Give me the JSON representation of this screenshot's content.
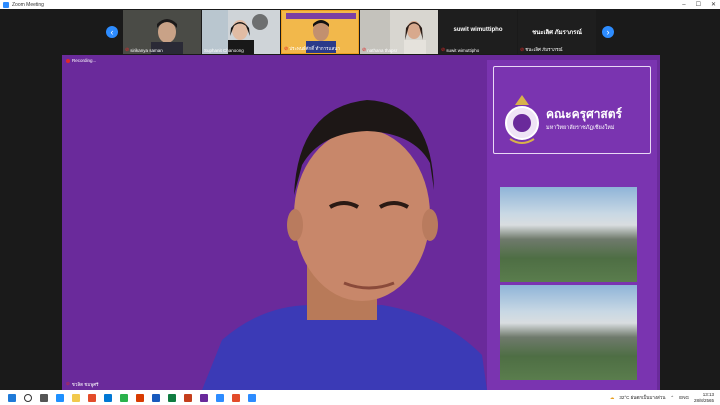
{
  "window": {
    "title": "Zoom Meeting",
    "app_icon": "zoom-icon"
  },
  "participants": [
    {
      "name": "sirikanya saman",
      "muted": true
    },
    {
      "name": "Suphanit Chanoong",
      "muted": false
    },
    {
      "name": "ประพนธ์ศักดิ์ ทำการแสนา",
      "muted": true
    },
    {
      "name": "nathana thapsr",
      "muted": true
    },
    {
      "name": "suwit wimuttipho",
      "muted": true,
      "video": false
    },
    {
      "name": "ชนะเลิศ ภัมราภรณ์",
      "muted": true,
      "video": false
    }
  ],
  "stage": {
    "recording_label": "Recording...",
    "speaker_name": "ชวลิต ชมพูศรี",
    "banner_title": "คณะครุศาสตร์",
    "banner_subtitle": "มหาวิทยาลัยราชภัฏเชียงใหม่"
  },
  "taskbar": {
    "weather": "32°C ฝนตกเป็นบางส่วน",
    "lang": "ENG",
    "time": "13:13",
    "date": "28/8/2565"
  },
  "colors": {
    "stage_bg": "#6a2a9b",
    "panel_bg": "#7a34b0",
    "zoom_blue": "#2d8cff",
    "muted_red": "#e02828"
  }
}
